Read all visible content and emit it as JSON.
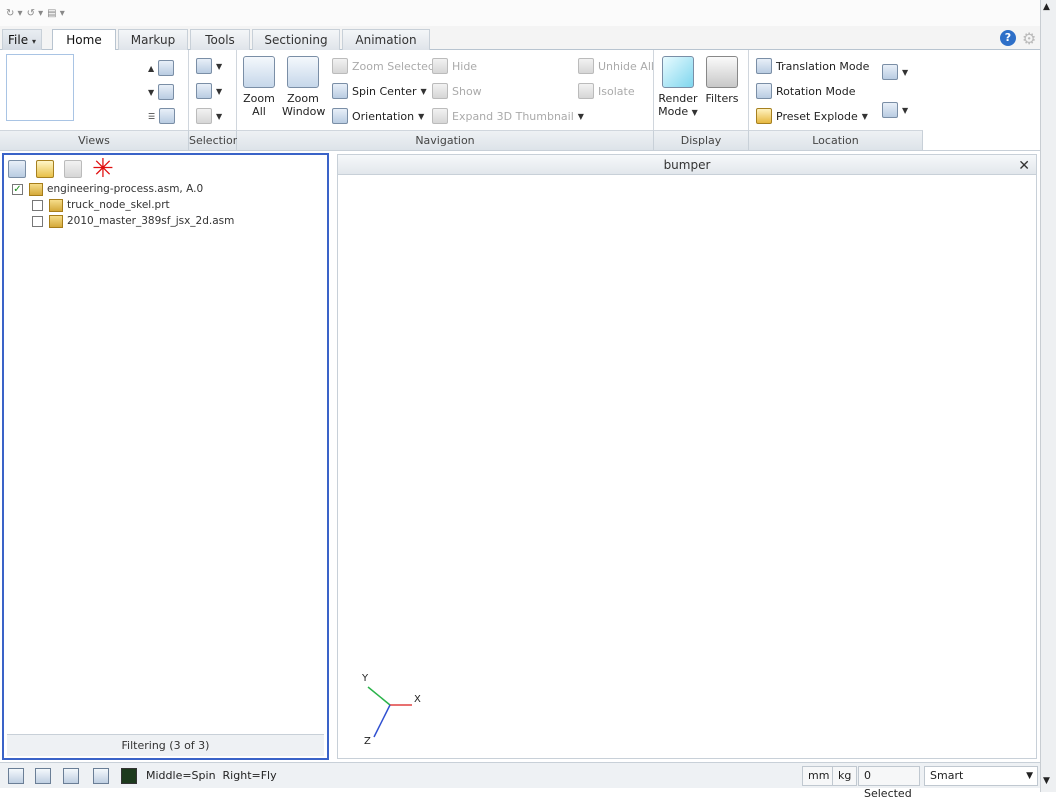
{
  "tabs": {
    "file": "File",
    "home": "Home",
    "markup": "Markup",
    "tools": "Tools",
    "sectioning": "Sectioning",
    "animation": "Animation"
  },
  "ribbon": {
    "groups": {
      "views": "Views",
      "selection": "Selection",
      "navigation": "Navigation",
      "display": "Display",
      "location": "Location"
    },
    "zoom_all": "Zoom\nAll",
    "zoom_window": "Zoom\nWindow",
    "zoom_selected": "Zoom Selected",
    "spin_center": "Spin Center",
    "orientation": "Orientation",
    "hide": "Hide",
    "show": "Show",
    "expand_3d": "Expand 3D Thumbnail",
    "unhide_all": "Unhide All",
    "isolate": "Isolate",
    "render_mode": "Render\nMode",
    "filters": "Filters",
    "translation_mode": "Translation Mode",
    "rotation_mode": "Rotation Mode",
    "preset_explode": "Preset Explode"
  },
  "tree": {
    "items": [
      {
        "label": "engineering-process.asm, A.0",
        "checked": true
      },
      {
        "label": "truck_node_skel.prt",
        "checked": false
      },
      {
        "label": "2010_master_389sf_jsx_2d.asm",
        "checked": false
      }
    ],
    "footer": "Filtering (3 of 3)"
  },
  "viewport": {
    "title": "bumper",
    "axis": {
      "x": "X",
      "y": "Y",
      "z": "Z"
    }
  },
  "status": {
    "hint": "Middle=Spin  Right=Fly",
    "units_len": "mm",
    "units_mass": "kg",
    "selected": "0 Selected",
    "filter": "Smart"
  },
  "colors": {
    "accent": "#3a63c8",
    "x_axis": "#e04040",
    "y_axis": "#2bb34a",
    "z_axis": "#3050d0"
  }
}
